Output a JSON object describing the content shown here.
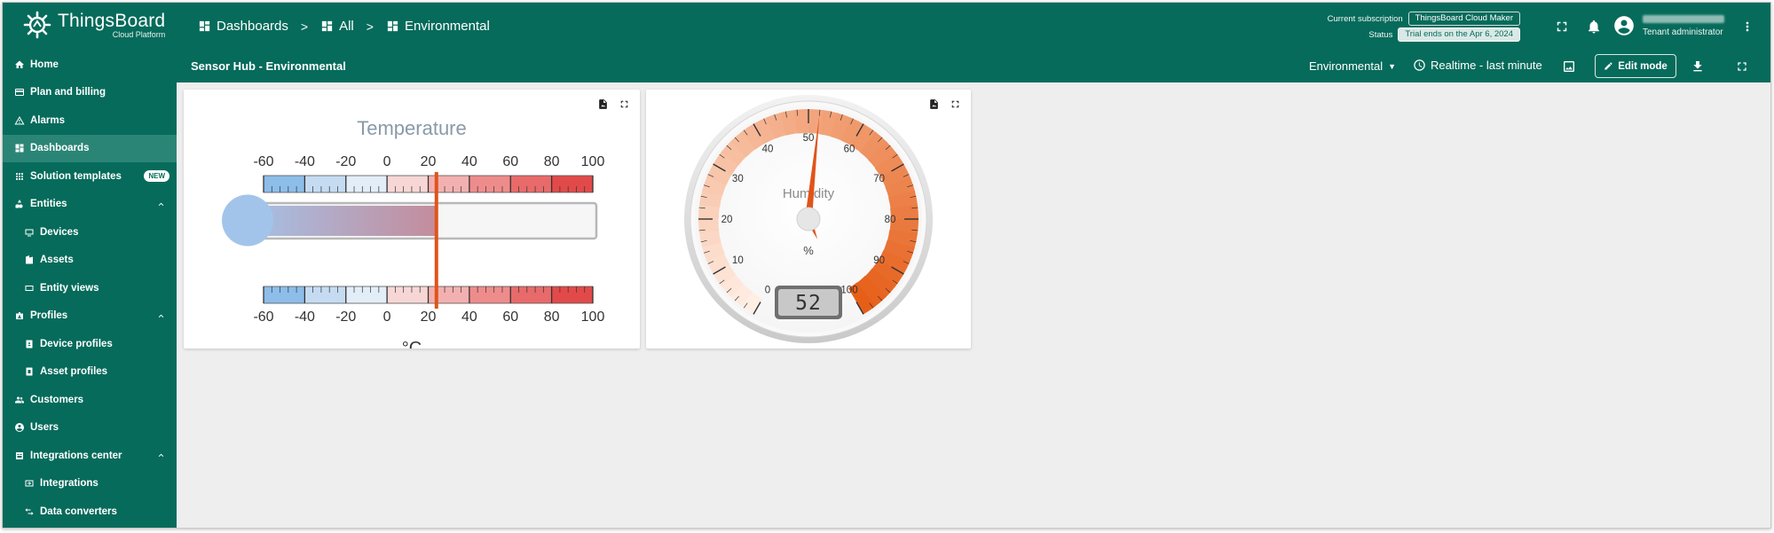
{
  "app": {
    "brand": "ThingsBoard",
    "brand_sub": "Cloud Platform"
  },
  "breadcrumb": [
    {
      "label": "Dashboards"
    },
    {
      "label": "All"
    },
    {
      "label": "Environmental"
    }
  ],
  "breadcrumb_separator": ">",
  "subscription": {
    "current_label": "Current subscription",
    "current_value": "ThingsBoard Cloud Maker",
    "status_label": "Status",
    "status_value": "Trial ends on the Apr 6, 2024"
  },
  "user": {
    "role": "Tenant administrator"
  },
  "sidebar": {
    "items": [
      {
        "label": "Home",
        "icon": "home-icon"
      },
      {
        "label": "Plan and billing",
        "icon": "billing-icon"
      },
      {
        "label": "Alarms",
        "icon": "alarm-icon"
      },
      {
        "label": "Dashboards",
        "icon": "dashboard-icon",
        "active": true
      },
      {
        "label": "Solution templates",
        "icon": "grid-icon",
        "badge": "NEW"
      },
      {
        "label": "Entities",
        "icon": "entities-icon",
        "expanded": true
      },
      {
        "label": "Devices",
        "icon": "devices-icon",
        "sub": true
      },
      {
        "label": "Assets",
        "icon": "assets-icon",
        "sub": true
      },
      {
        "label": "Entity views",
        "icon": "entity-views-icon",
        "sub": true
      },
      {
        "label": "Profiles",
        "icon": "profiles-icon",
        "expanded": true
      },
      {
        "label": "Device profiles",
        "icon": "device-profile-icon",
        "sub": true
      },
      {
        "label": "Asset profiles",
        "icon": "asset-profile-icon",
        "sub": true
      },
      {
        "label": "Customers",
        "icon": "customers-icon"
      },
      {
        "label": "Users",
        "icon": "users-icon"
      },
      {
        "label": "Integrations center",
        "icon": "integrations-center-icon",
        "expanded": true
      },
      {
        "label": "Integrations",
        "icon": "integrations-icon",
        "sub": true
      },
      {
        "label": "Data converters",
        "icon": "converters-icon",
        "sub": true
      }
    ]
  },
  "dashboard": {
    "title": "Sensor Hub - Environmental",
    "state": "Environmental",
    "timewindow": "Realtime - last minute",
    "edit_label": "Edit mode"
  },
  "temperature_widget": {
    "title": "Temperature",
    "unit": "°C",
    "min": -60,
    "max": 100,
    "major_ticks": [
      "-60",
      "-40",
      "-20",
      "0",
      "20",
      "40",
      "60",
      "80",
      "100"
    ],
    "value": 24
  },
  "humidity_widget": {
    "title": "Humidity",
    "unit": "%",
    "min": 0,
    "max": 100,
    "major_ticks": [
      "0",
      "10",
      "20",
      "30",
      "40",
      "50",
      "60",
      "70",
      "80",
      "90",
      "100"
    ],
    "value": 52,
    "value_display": "52"
  },
  "colors": {
    "primary": "#066b5b",
    "sidebar_active": "#2b8576",
    "background": "#eeeeee",
    "needle": "#e0541a"
  }
}
